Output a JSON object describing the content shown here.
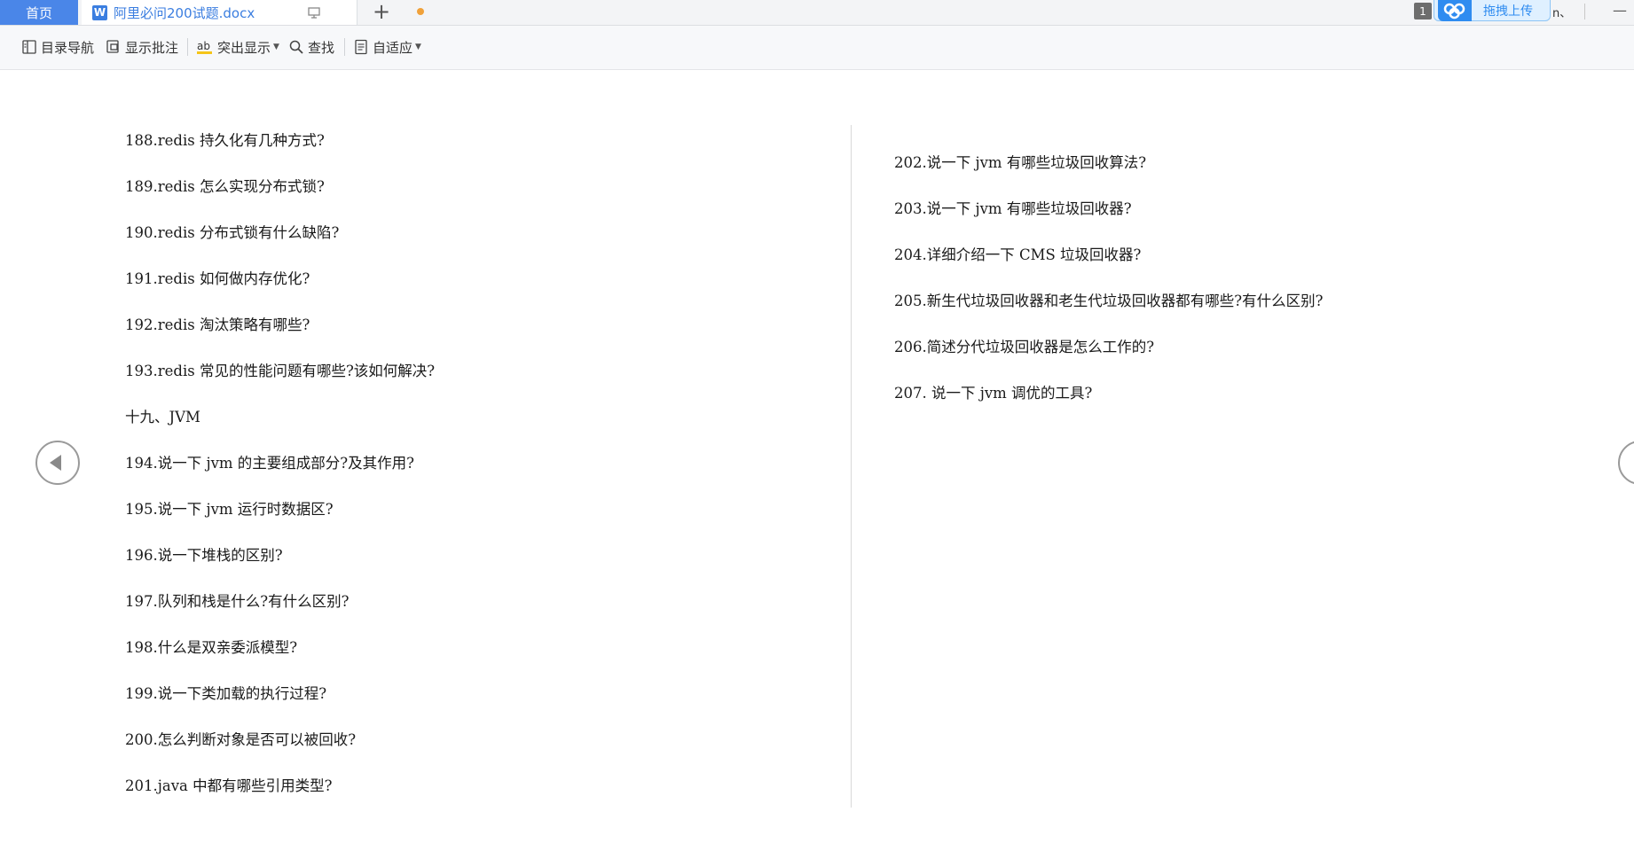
{
  "tabs": {
    "home_label": "首页",
    "document_title": "阿里必问200试题.docx",
    "new_tab_symbol": "+"
  },
  "top_right": {
    "page_badge": "1",
    "upload_label": "拖拽上传",
    "partial_text": "n、",
    "minimize_symbol": "—"
  },
  "toolbar": {
    "items": [
      {
        "label": "目录导航",
        "icon": "toc-nav-icon"
      },
      {
        "label": "显示批注",
        "icon": "comments-icon"
      },
      {
        "label": "突出显示",
        "icon": "highlight-icon"
      },
      {
        "label": "查找",
        "icon": "search-icon"
      },
      {
        "label": "自适应",
        "icon": "fit-page-icon"
      }
    ]
  },
  "document": {
    "left_column": [
      "188.redis  持久化有几种方式?",
      "189.redis  怎么实现分布式锁?",
      "190.redis  分布式锁有什么缺陷?",
      "191.redis  如何做内存优化?",
      "192.redis  淘汰策略有哪些?",
      "193.redis  常见的性能问题有哪些?该如何解决?",
      "十九、JVM",
      "194.说一下  jvm  的主要组成部分?及其作用?",
      "195.说一下  jvm  运行时数据区?",
      "196.说一下堆栈的区别?",
      "197.队列和栈是什么?有什么区别?",
      "198.什么是双亲委派模型?",
      "199.说一下类加载的执行过程?",
      "200.怎么判断对象是否可以被回收?",
      "201.java  中都有哪些引用类型?"
    ],
    "right_column": [
      "202.说一下  jvm  有哪些垃圾回收算法?",
      "203.说一下  jvm  有哪些垃圾回收器?",
      "204.详细介绍一下  CMS  垃圾回收器?",
      "205.新生代垃圾回收器和老生代垃圾回收器都有哪些?有什么区别?",
      "206.简述分代垃圾回收器是怎么工作的?",
      "207. 说一下  jvm  调优的工具?"
    ]
  },
  "colors": {
    "accent": "#4a86e8",
    "tab_title": "#3b7ee0",
    "upload_bg": "#dff0ff",
    "modified_dot": "#f0a13a"
  }
}
